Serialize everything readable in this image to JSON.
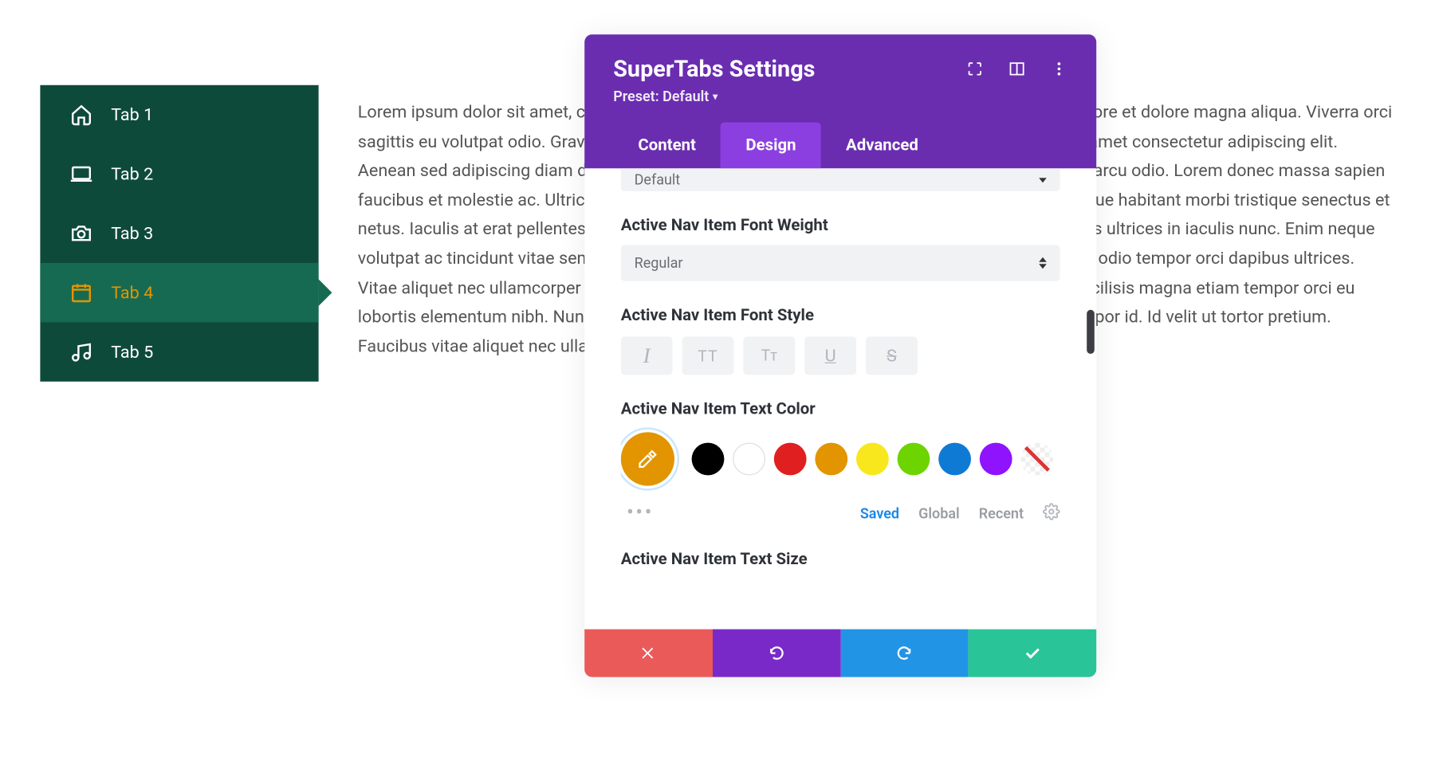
{
  "sidebar": {
    "items": [
      {
        "label": "Tab 1",
        "icon": "home",
        "active": false
      },
      {
        "label": "Tab 2",
        "icon": "laptop",
        "active": false
      },
      {
        "label": "Tab 3",
        "icon": "camera",
        "active": false
      },
      {
        "label": "Tab 4",
        "icon": "calendar",
        "active": true
      },
      {
        "label": "Tab 5",
        "icon": "music",
        "active": false
      }
    ]
  },
  "content": {
    "paragraph": "Lorem ipsum dolor sit amet, consectetur adipiscing elit, sed do eiusmod tempor incididunt ut labore et dolore magna aliqua. Viverra orci sagittis eu volutpat odio. Gravida quis blandit turpis cursus. Id ornare arcu odio ut sem nulla. Sit amet consectetur adipiscing elit. Aenean sed adipiscing diam donec adipiscing. In hendrerit gravida rutrum quisque. Dui id ornare arcu odio. Lorem donec massa sapien faucibus et molestie ac. Ultrices in iaculis nunc sed augue. Consectetur adipiscing elit pellentesque habitant morbi tristique senectus et netus. Iaculis at erat pellentesque adipiscing commodo elit at. Donec ac odio tempor orci dapibus ultrices in iaculis nunc. Enim neque volutpat ac tincidunt vitae semper quis lectus. Pretium viverra suspendisse potenti nullam ac. Ac odio tempor orci dapibus ultrices. Vitae aliquet nec ullamcorper sit amet risus nullam eget felis. Nisl vel pretium lectus quam id. Facilisis magna etiam tempor orci eu lobortis elementum nibh. Nunc lobortis mattis aliquam faucibus purus in. A diam sollicitudin tempor id. Id velit ut tortor pretium. Faucibus vitae aliquet nec ullamcorper."
  },
  "modal": {
    "title": "SuperTabs Settings",
    "preset_label": "Preset: Default",
    "tabs": {
      "content": "Content",
      "design": "Design",
      "advanced": "Advanced",
      "active": "design"
    },
    "fields": {
      "font_clipped_value": "Default",
      "font_weight_label": "Active Nav Item Font Weight",
      "font_weight_value": "Regular",
      "font_style_label": "Active Nav Item Font Style",
      "text_color_label": "Active Nav Item Text Color",
      "text_size_label": "Active Nav Item Text Size"
    },
    "style_buttons": [
      "I",
      "TT",
      "Tᴛ",
      "U",
      "S"
    ],
    "colors": {
      "selected": "#e29500",
      "swatches": [
        "#000000",
        "#ffffff",
        "#e02020",
        "#e29500",
        "#f8e71c",
        "#6dd400",
        "#0f7ad4",
        "#9013fe"
      ]
    },
    "palette_tabs": {
      "saved": "Saved",
      "global": "Global",
      "recent": "Recent",
      "active": "saved"
    },
    "footer": {
      "cancel": "cancel",
      "undo": "undo",
      "redo": "redo",
      "confirm": "confirm"
    }
  }
}
